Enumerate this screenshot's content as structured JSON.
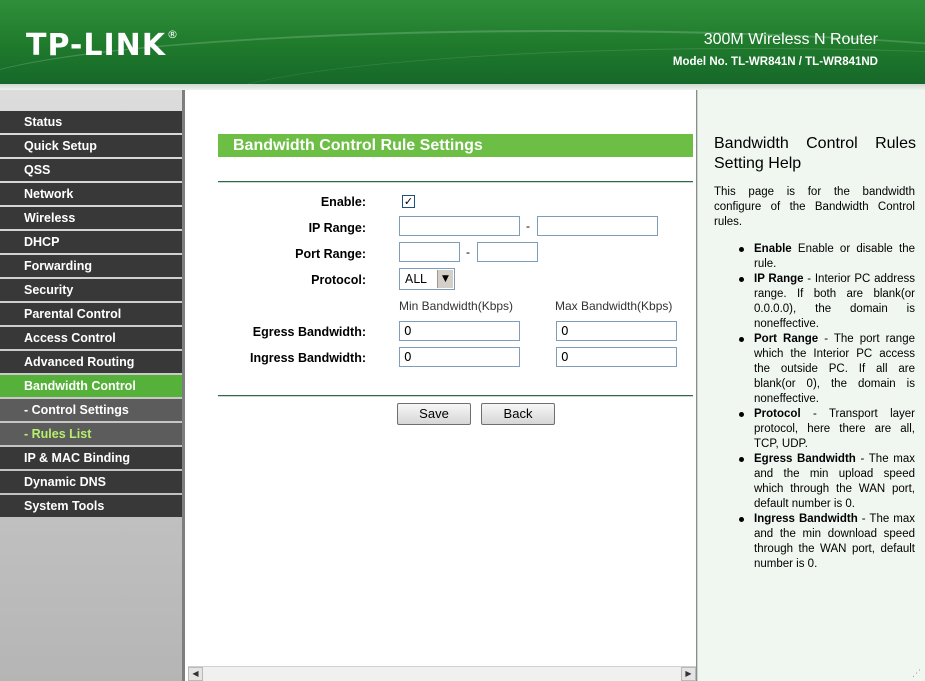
{
  "header": {
    "logo": "TP-LINK",
    "logo_mark": "®",
    "product": "300M Wireless N Router",
    "model": "Model No. TL-WR841N / TL-WR841ND"
  },
  "sidebar": {
    "items": [
      {
        "label": "Status"
      },
      {
        "label": "Quick Setup"
      },
      {
        "label": "QSS"
      },
      {
        "label": "Network"
      },
      {
        "label": "Wireless"
      },
      {
        "label": "DHCP"
      },
      {
        "label": "Forwarding"
      },
      {
        "label": "Security"
      },
      {
        "label": "Parental Control"
      },
      {
        "label": "Access Control"
      },
      {
        "label": "Advanced Routing"
      },
      {
        "label": "Bandwidth Control"
      },
      {
        "label": "- Control Settings"
      },
      {
        "label": "- Rules List"
      },
      {
        "label": "IP & MAC Binding"
      },
      {
        "label": "Dynamic DNS"
      },
      {
        "label": "System Tools"
      }
    ]
  },
  "main": {
    "title": "Bandwidth Control Rule Settings",
    "labels": {
      "enable": "Enable:",
      "ip_range": "IP Range:",
      "port_range": "Port Range:",
      "protocol": "Protocol:",
      "egress": "Egress Bandwidth:",
      "ingress": "Ingress Bandwidth:"
    },
    "enable_checked": true,
    "check_glyph": "✓",
    "range_separator": "-",
    "ip_start": "",
    "ip_end": "",
    "port_start": "",
    "port_end": "",
    "protocol_value": "ALL",
    "protocol_arrow": "▼",
    "col_min": "Min Bandwidth(Kbps)",
    "col_max": "Max Bandwidth(Kbps)",
    "egress_min": "0",
    "egress_max": "0",
    "ingress_min": "0",
    "ingress_max": "0",
    "save_label": "Save",
    "back_label": "Back",
    "scroll_left": "◀",
    "scroll_right": "▶"
  },
  "help": {
    "title": "Bandwidth Control Rules Setting Help",
    "intro": "This page is for the bandwidth configure of the Bandwidth Control rules.",
    "items": [
      {
        "term": "Enable",
        "desc": " Enable or disable the rule."
      },
      {
        "term": "IP Range",
        "desc": " - Interior PC address range. If both are blank(or 0.0.0.0), the domain is noneffective."
      },
      {
        "term": "Port Range",
        "desc": " - The port range which the Interior PC access the outside PC. If all are blank(or 0), the domain is noneffective."
      },
      {
        "term": "Protocol",
        "desc": " - Transport layer protocol, here there are all, TCP, UDP."
      },
      {
        "term": "Egress Bandwidth",
        "desc": " - The max and the min upload speed which through the WAN port, default number is 0."
      },
      {
        "term": "Ingress Bandwidth",
        "desc": " - The max and the min download speed through the WAN port, default number is 0."
      }
    ]
  },
  "colors": {
    "brand_green": "#1f7a2c",
    "active_menu": "#55b139",
    "title_bar": "#6cbe45",
    "menu_bg": "#383838",
    "submenu_current_text": "#b7f06a"
  }
}
